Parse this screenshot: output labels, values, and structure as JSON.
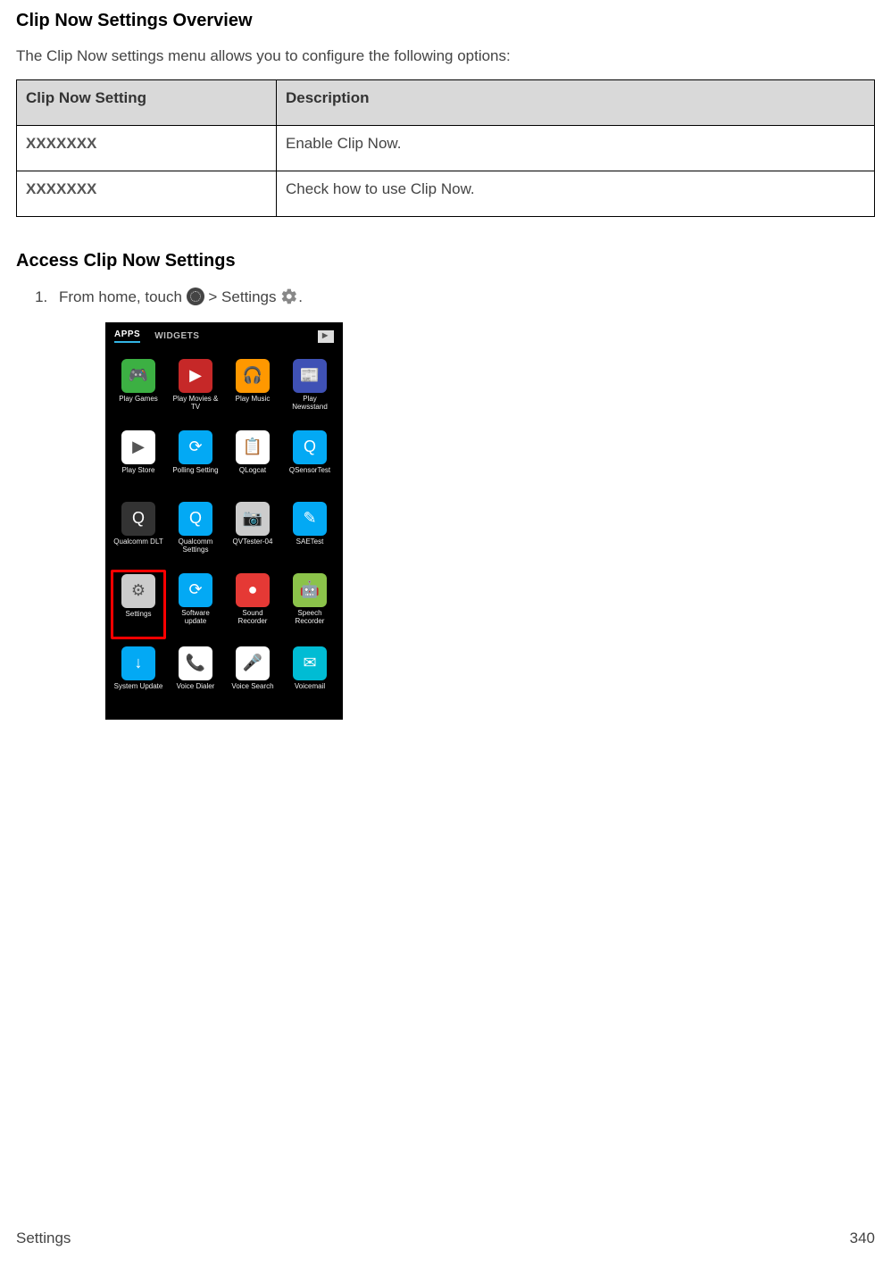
{
  "heading_overview": "Clip Now Settings Overview",
  "intro": "The Clip Now settings menu allows you to configure the following options:",
  "table": {
    "header_setting": "Clip Now Setting",
    "header_desc": "Description",
    "rows": [
      {
        "setting": "XXXXXXX",
        "desc": "Enable Clip Now."
      },
      {
        "setting": "XXXXXXX",
        "desc": "Check how to use Clip Now."
      }
    ]
  },
  "heading_access": "Access Clip Now Settings",
  "step1_prefix": "From home, touch ",
  "step1_mid": " > Settings ",
  "step1_suffix": ".",
  "phone": {
    "tabs": {
      "apps": "APPS",
      "widgets": "WIDGETS"
    },
    "grid": [
      {
        "label": "Play Games",
        "color": "#3cb043",
        "glyph": "🎮"
      },
      {
        "label": "Play Movies & TV",
        "color": "#c62828",
        "glyph": "▶"
      },
      {
        "label": "Play Music",
        "color": "#ff9800",
        "glyph": "🎧"
      },
      {
        "label": "Play Newsstand",
        "color": "#3f51b5",
        "glyph": "📰"
      },
      {
        "label": "Play Store",
        "color": "#ffffff",
        "glyph": "▶"
      },
      {
        "label": "Polling Setting",
        "color": "#03a9f4",
        "glyph": "⟳"
      },
      {
        "label": "QLogcat",
        "color": "#ffffff",
        "glyph": "📋"
      },
      {
        "label": "QSensorTest",
        "color": "#03a9f4",
        "glyph": "Q"
      },
      {
        "label": "Qualcomm DLT",
        "color": "#333333",
        "glyph": "Q"
      },
      {
        "label": "Qualcomm Settings",
        "color": "#03a9f4",
        "glyph": "Q"
      },
      {
        "label": "QVTester-04",
        "color": "#cccccc",
        "glyph": "📷"
      },
      {
        "label": "SAETest",
        "color": "#03a9f4",
        "glyph": "✎"
      },
      {
        "label": "Settings",
        "color": "#cccccc",
        "glyph": "⚙",
        "highlight": true
      },
      {
        "label": "Software update",
        "color": "#03a9f4",
        "glyph": "⟳"
      },
      {
        "label": "Sound Recorder",
        "color": "#e53935",
        "glyph": "●"
      },
      {
        "label": "Speech Recorder",
        "color": "#8bc34a",
        "glyph": "🤖"
      },
      {
        "label": "System Update",
        "color": "#03a9f4",
        "glyph": "↓"
      },
      {
        "label": "Voice Dialer",
        "color": "#ffffff",
        "glyph": "📞"
      },
      {
        "label": "Voice Search",
        "color": "#ffffff",
        "glyph": "🎤"
      },
      {
        "label": "Voicemail",
        "color": "#00bcd4",
        "glyph": "✉"
      }
    ]
  },
  "footer_left": "Settings",
  "footer_right": "340"
}
